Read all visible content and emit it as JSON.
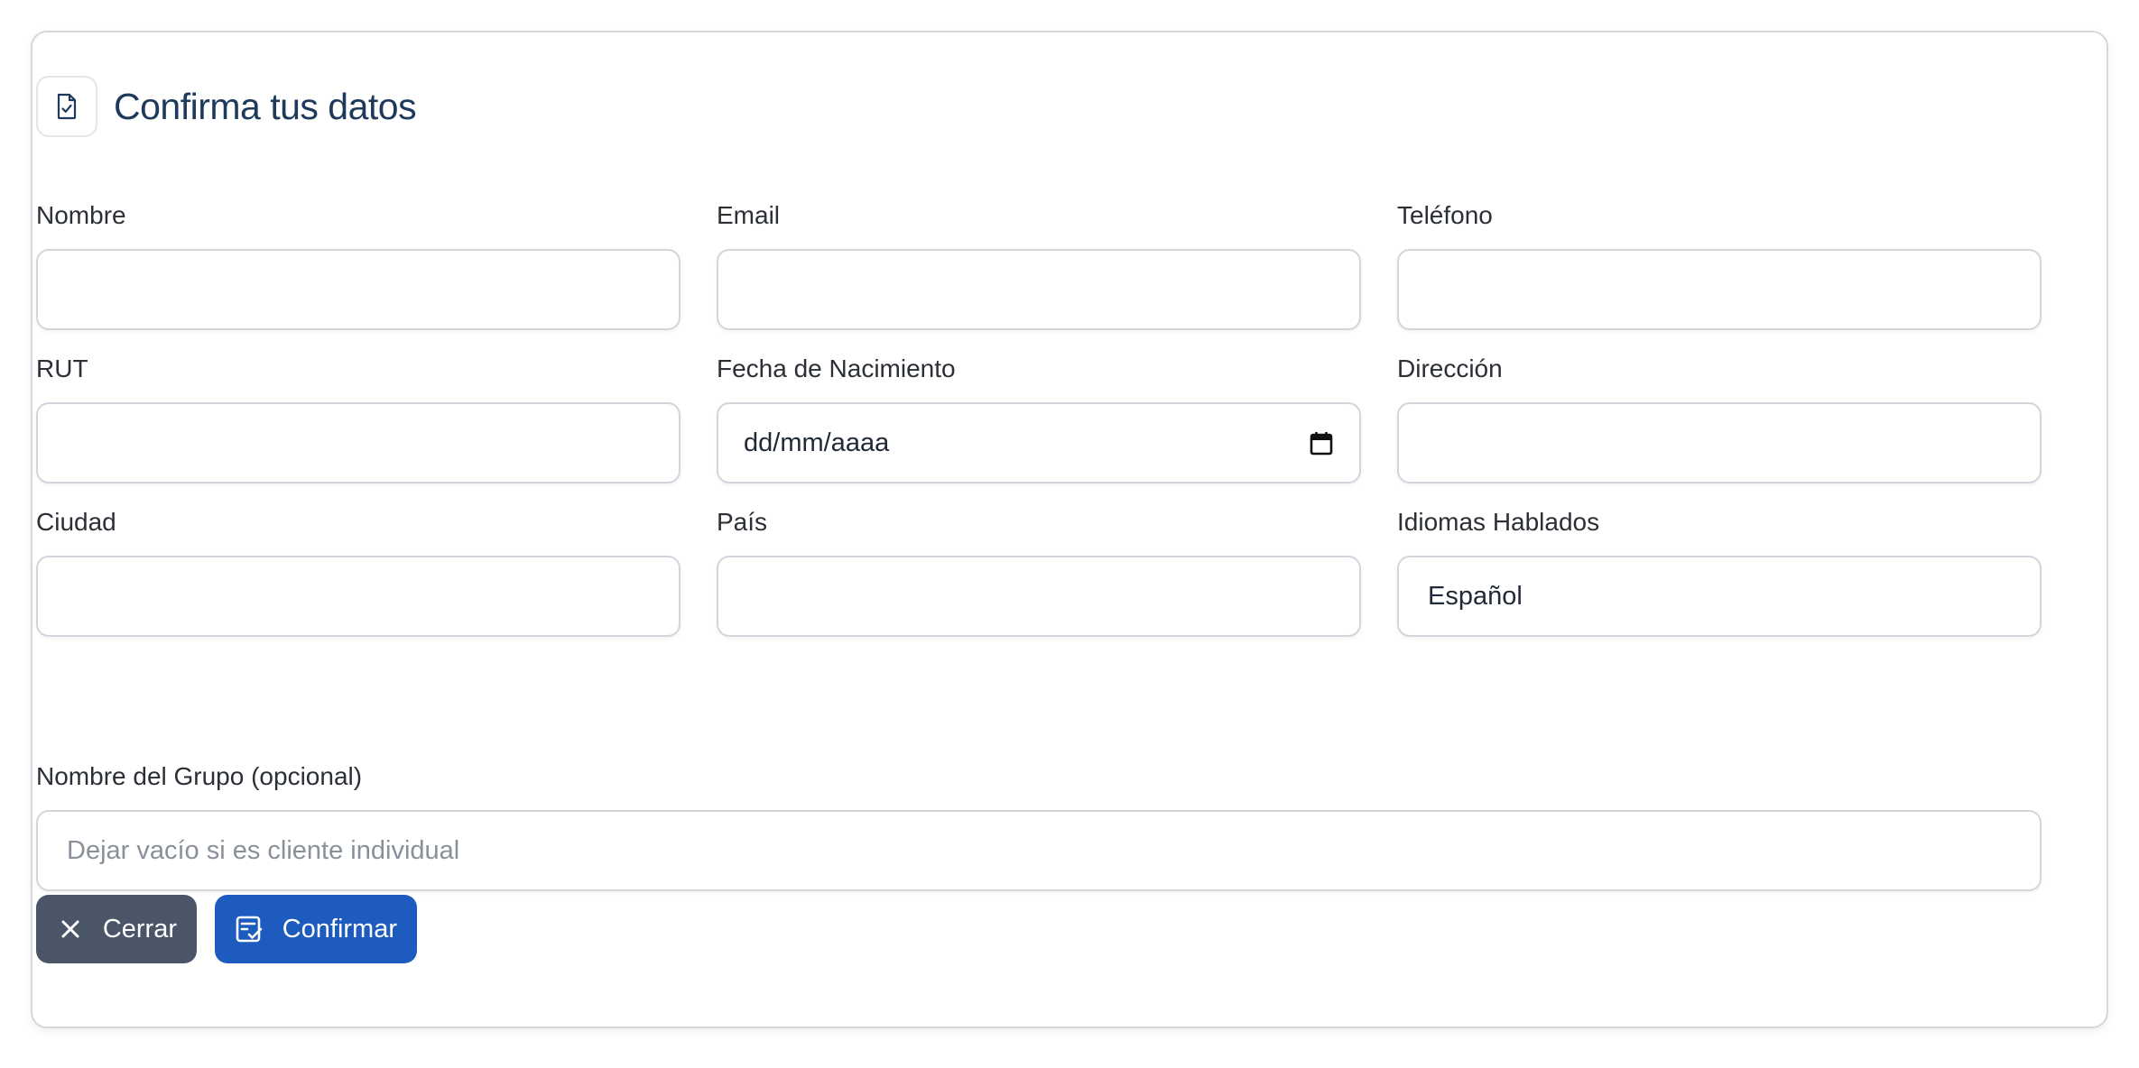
{
  "header": {
    "title": "Confirma tus datos",
    "icon": "document-check-icon"
  },
  "fields": [
    {
      "key": "nombre",
      "label": "Nombre",
      "value": "",
      "placeholder": ""
    },
    {
      "key": "email",
      "label": "Email",
      "value": "",
      "placeholder": ""
    },
    {
      "key": "telefono",
      "label": "Teléfono",
      "value": "",
      "placeholder": ""
    },
    {
      "key": "rut",
      "label": "RUT",
      "value": "",
      "placeholder": ""
    },
    {
      "key": "fecha",
      "label": "Fecha de Nacimiento",
      "value": "dd/mm/aaaa",
      "placeholder": ""
    },
    {
      "key": "direccion",
      "label": "Dirección",
      "value": "",
      "placeholder": ""
    },
    {
      "key": "ciudad",
      "label": "Ciudad",
      "value": "",
      "placeholder": ""
    },
    {
      "key": "pais",
      "label": "País",
      "value": "",
      "placeholder": ""
    },
    {
      "key": "idiomas",
      "label": "Idiomas Hablados",
      "value": "Español",
      "placeholder": ""
    }
  ],
  "group": {
    "label": "Nombre del Grupo (opcional)",
    "placeholder": "Dejar vacío si es cliente individual"
  },
  "buttons": {
    "close_label": "Cerrar",
    "confirm_label": "Confirmar"
  },
  "colors": {
    "title": "#1d3a5c",
    "close_button": "#4a5568",
    "confirm_button": "#1d5bbf"
  }
}
